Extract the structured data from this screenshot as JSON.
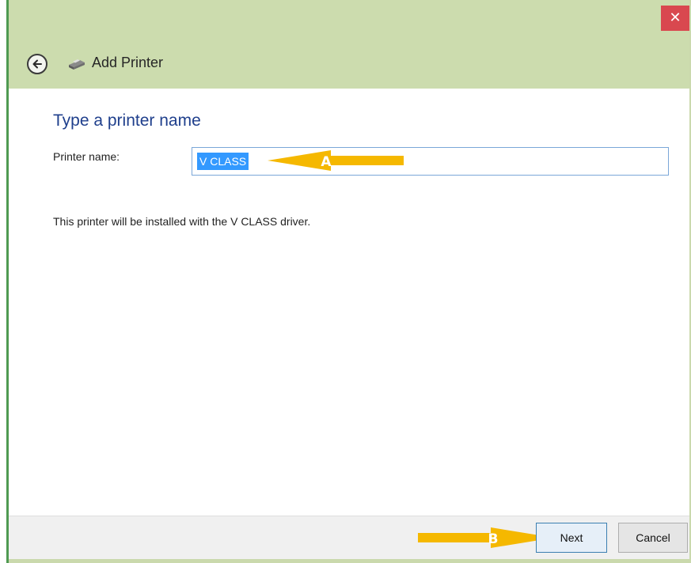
{
  "window": {
    "close_glyph": "✕"
  },
  "header": {
    "title": "Add Printer",
    "back_icon": "back-arrow-icon",
    "app_icon": "printer-icon"
  },
  "main": {
    "heading": "Type a printer name",
    "printer_name_label": "Printer name:",
    "printer_name_value": "V CLASS",
    "driver_text": "This printer will be installed with the V CLASS driver."
  },
  "footer": {
    "next_label": "Next",
    "cancel_label": "Cancel"
  },
  "annotations": {
    "arrow_a_label": "A",
    "arrow_b_label": "B"
  },
  "colors": {
    "accent": "#1f3f8c",
    "titlebar": "#ccdcae",
    "close": "#d9484f",
    "callout": "#f5b800",
    "selection": "#3399ff"
  }
}
